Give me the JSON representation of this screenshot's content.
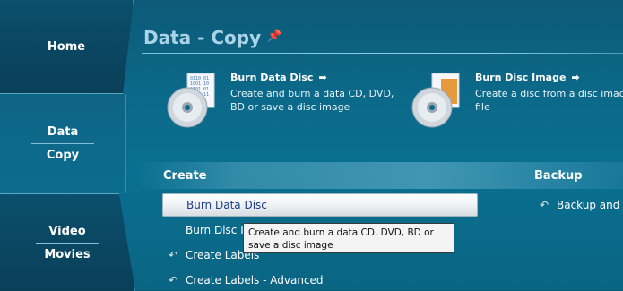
{
  "nav": {
    "home": "Home",
    "data_line1": "Data",
    "data_line2": "Copy",
    "video_line1": "Video",
    "video_line2": "Movies"
  },
  "header": {
    "title": "Data - Copy"
  },
  "features": [
    {
      "title": "Burn Data Disc",
      "desc": "Create and burn a data CD, DVD, BD or save a disc image"
    },
    {
      "title": "Burn Disc Image",
      "desc": "Create a disc from a disc image file"
    }
  ],
  "sections": {
    "create": "Create",
    "backup": "Backup"
  },
  "create_items": [
    "Burn Data Disc",
    "Burn Disc Image",
    "Create Labels",
    "Create Labels - Advanced"
  ],
  "backup_items": [
    "Backup and Restore"
  ],
  "tooltip": "Create and burn a data CD, DVD, BD or save a disc image",
  "colors": {
    "accent_title": "#a9d3e6",
    "selected_text": "#1d3e8a",
    "background": "#0b6a8a"
  }
}
